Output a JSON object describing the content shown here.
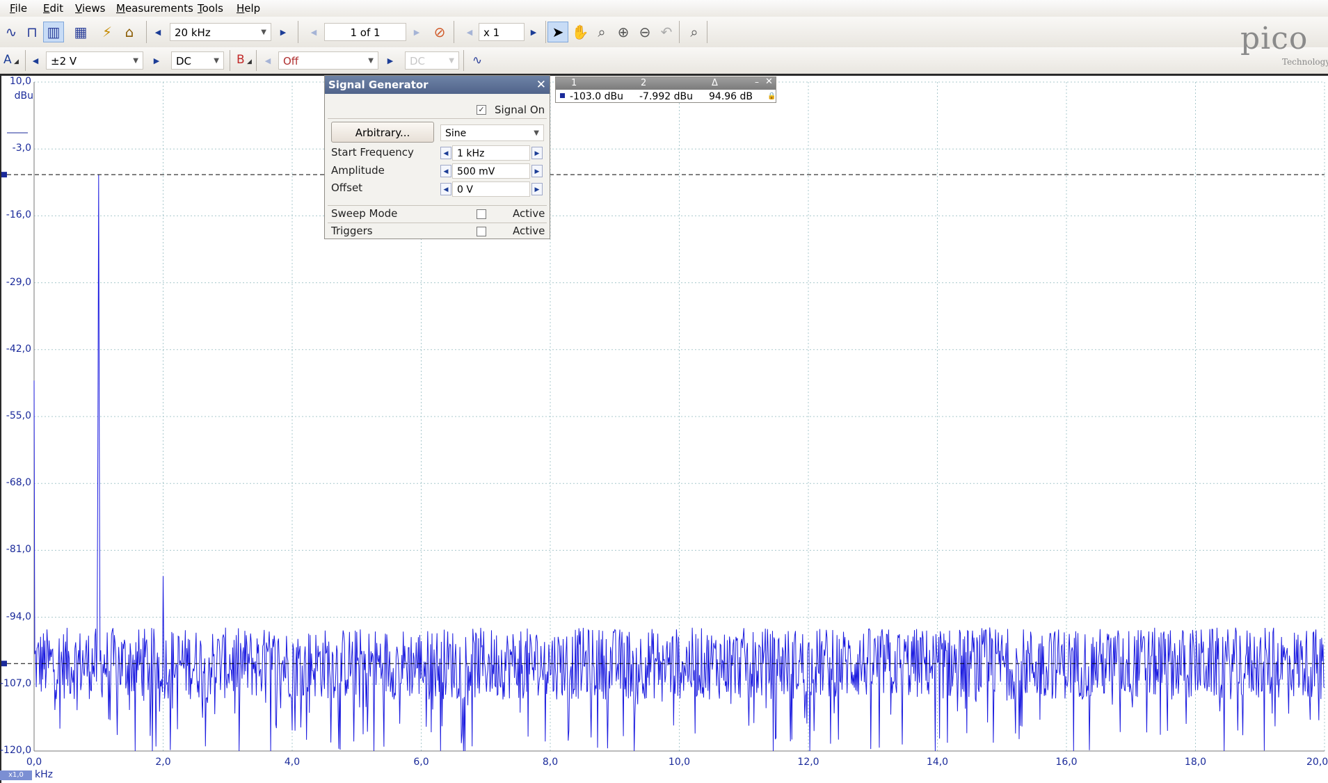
{
  "menu": [
    "File",
    "Edit",
    "Views",
    "Measurements",
    "Tools",
    "Help"
  ],
  "toolbar1": {
    "timebase": "20 kHz",
    "capture_counter": "1 of 1",
    "zoom_factor": "x 1"
  },
  "toolbar2": {
    "channel_a_label": "A",
    "channel_a_range": "±2 V",
    "channel_a_coupling": "DC",
    "channel_b_label": "B",
    "channel_b_range": "Off",
    "channel_b_coupling": "DC"
  },
  "logo": {
    "word": "pico",
    "sub": "Technology"
  },
  "signal_generator": {
    "title": "Signal Generator",
    "signal_on_label": "Signal On",
    "signal_on_checked": true,
    "arbitrary_label": "Arbitrary...",
    "waveform": "Sine",
    "start_frequency_label": "Start Frequency",
    "start_frequency_value": "1 kHz",
    "amplitude_label": "Amplitude",
    "amplitude_value": "500 mV",
    "offset_label": "Offset",
    "offset_value": "0 V",
    "sweep_mode_label": "Sweep Mode",
    "sweep_active_label": "Active",
    "triggers_label": "Triggers",
    "triggers_active_label": "Active"
  },
  "measurement_table": {
    "headers": [
      "1",
      "2",
      "Δ"
    ],
    "values": [
      "-103.0 dBu",
      "-7.992 dBu",
      "94.96 dB"
    ]
  },
  "axis": {
    "y_unit": "dBu",
    "x_unit": "kHz",
    "x_scale": "x1,0"
  },
  "chart_data": {
    "type": "line",
    "title": "",
    "xlabel": "kHz",
    "ylabel": "dBu",
    "xlim": [
      0,
      20
    ],
    "ylim": [
      -120,
      10
    ],
    "y_ticks": [
      "10,0",
      "-3,0",
      "-16,0",
      "-29,0",
      "-42,0",
      "-55,0",
      "-68,0",
      "-81,0",
      "-94,0",
      "-107,0",
      "-120,0"
    ],
    "x_ticks": [
      "0,0",
      "2,0",
      "4,0",
      "6,0",
      "8,0",
      "10,0",
      "12,0",
      "14,0",
      "16,0",
      "18,0",
      "20,0"
    ],
    "grid": true,
    "series": [
      {
        "color": "#1a1adf",
        "noise_floor": -103,
        "peaks": [
          [
            1.0,
            -7.992
          ],
          [
            2.0,
            -86
          ],
          [
            0.0,
            -48
          ],
          [
            15.75,
            -93
          ]
        ]
      }
    ],
    "rulers": {
      "ruler1": -103.0,
      "ruler2": -7.992
    }
  }
}
